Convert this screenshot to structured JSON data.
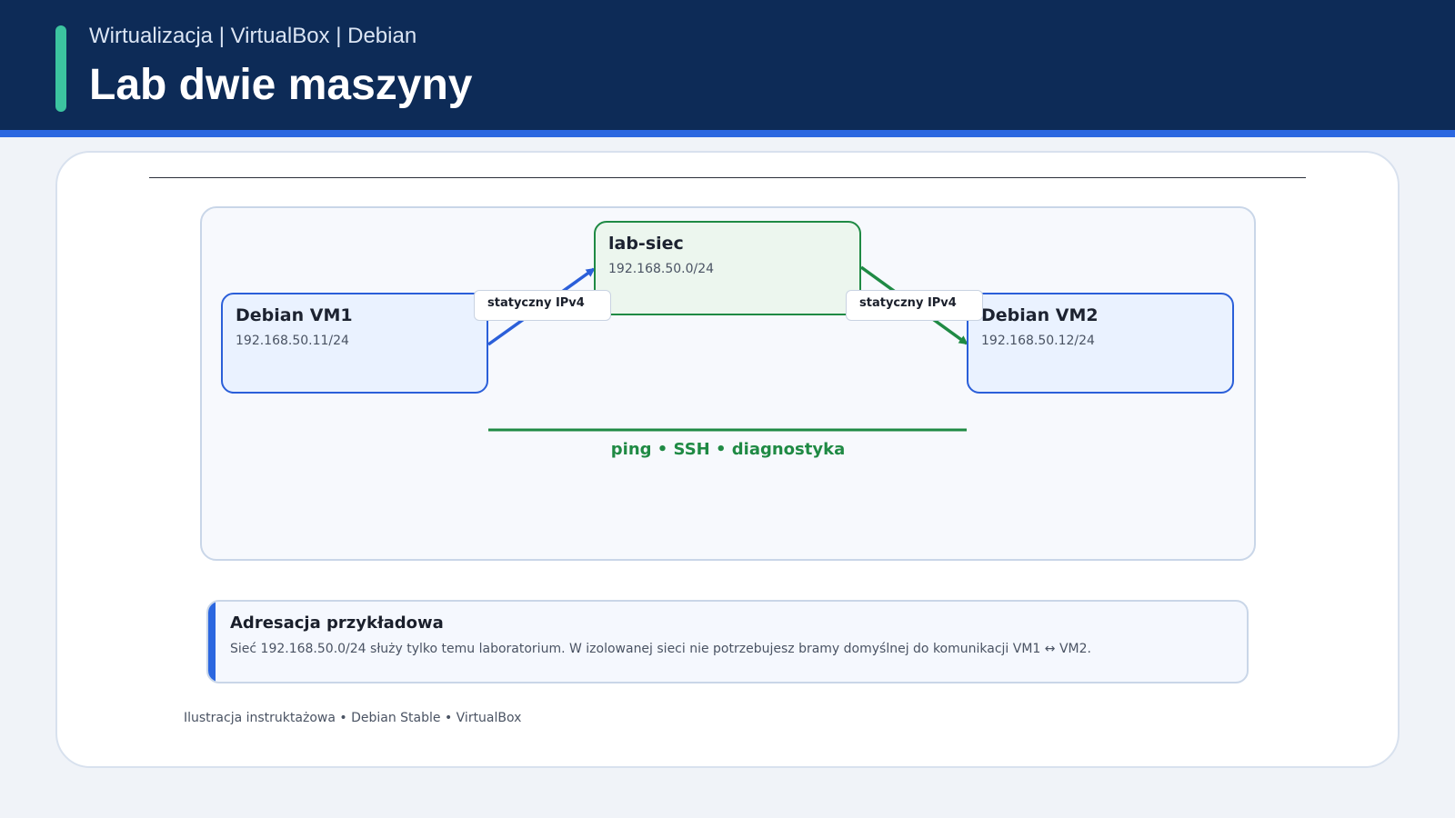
{
  "header": {
    "subtitle": "Wirtualizacja | VirtualBox | Debian",
    "title": "Lab dwie maszyny"
  },
  "diagram": {
    "nodes": {
      "vm1": {
        "title": "Debian VM1",
        "ip": "192.168.50.11/24"
      },
      "net": {
        "title": "lab-siec",
        "ip": "192.168.50.0/24"
      },
      "vm2": {
        "title": "Debian VM2",
        "ip": "192.168.50.12/24"
      }
    },
    "edge_labels": {
      "left": "statyczny IPv4",
      "right": "statyczny IPv4"
    },
    "connection_label": "ping • SSH • diagnostyka"
  },
  "note": {
    "title": "Adresacja przykładowa",
    "text": "Sieć 192.168.50.0/24 służy tylko temu laboratorium. W izolowanej sieci nie potrzebujesz bramy domyślnej do komunikacji VM1 ↔ VM2."
  },
  "footer": {
    "caption": "Ilustracja instruktażowa • Debian Stable • VirtualBox"
  },
  "colors": {
    "header_bg": "#0d2b57",
    "accent_blue": "#2b67e0",
    "accent_green": "#1f8a44",
    "header_accent": "#3cc4a0"
  }
}
